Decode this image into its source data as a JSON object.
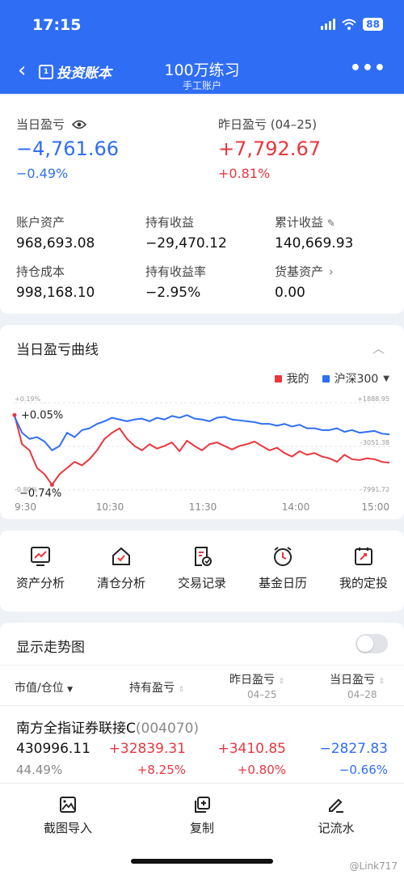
{
  "status": {
    "time": "17:15",
    "battery": "88"
  },
  "nav": {
    "brand": "投资账本",
    "title": "100万练习",
    "subtitle": "手工账户"
  },
  "colors": {
    "primary": "#2f6ef4",
    "down": "#2f6ef4",
    "up": "#e8373e"
  },
  "summary": {
    "today_label": "当日盈亏",
    "today_value": "−4,761.66",
    "today_pct": "−0.49%",
    "yesterday_label": "昨日盈亏 (04–25)",
    "yesterday_value": "+7,792.67",
    "yesterday_pct": "+0.81%",
    "metrics": [
      {
        "label": "账户资产",
        "value": "968,693.08"
      },
      {
        "label": "持有收益",
        "value": "−29,470.12"
      },
      {
        "label": "累计收益",
        "value": "140,669.93"
      },
      {
        "label": "持仓成本",
        "value": "998,168.10"
      },
      {
        "label": "持有收益率",
        "value": "−2.95%"
      },
      {
        "label": "货基资产",
        "value": "0.00"
      }
    ]
  },
  "chart_section": {
    "title": "当日盈亏曲线",
    "legend": [
      "我的",
      "沪深300"
    ]
  },
  "chart_data": {
    "type": "line",
    "x_ticks": [
      "9:30",
      "10:30",
      "11:30",
      "14:00",
      "15:00"
    ],
    "left_axis_labels": [
      "+0.19%",
      "-0.80%"
    ],
    "right_axis_labels": [
      "+1888.95",
      "-3051.38",
      "-7991.72"
    ],
    "annotations": [
      "+0.05%",
      "−0.74%"
    ],
    "x": [
      0,
      2,
      4,
      6,
      8,
      10,
      12,
      14,
      16,
      18,
      20,
      22,
      24,
      26,
      28,
      30,
      32,
      34,
      36,
      38,
      40,
      42,
      44,
      46,
      48,
      50,
      52,
      54,
      56,
      58,
      60,
      62,
      64,
      66,
      68,
      70,
      72,
      74,
      76,
      78,
      80,
      82,
      84,
      86,
      88,
      90,
      92,
      94,
      96,
      98,
      100
    ],
    "series": [
      {
        "name": "我的",
        "color": "#e8373e",
        "values": [
          0.05,
          -0.28,
          -0.35,
          -0.55,
          -0.62,
          -0.74,
          -0.62,
          -0.55,
          -0.48,
          -0.52,
          -0.45,
          -0.35,
          -0.22,
          -0.15,
          -0.1,
          -0.22,
          -0.3,
          -0.35,
          -0.28,
          -0.33,
          -0.3,
          -0.26,
          -0.36,
          -0.24,
          -0.3,
          -0.35,
          -0.28,
          -0.26,
          -0.3,
          -0.34,
          -0.3,
          -0.28,
          -0.25,
          -0.3,
          -0.35,
          -0.32,
          -0.38,
          -0.42,
          -0.36,
          -0.4,
          -0.38,
          -0.42,
          -0.44,
          -0.48,
          -0.4,
          -0.45,
          -0.46,
          -0.44,
          -0.45,
          -0.48,
          -0.49
        ]
      },
      {
        "name": "沪深300",
        "color": "#2f6ef4",
        "values": [
          0.03,
          -0.15,
          -0.22,
          -0.2,
          -0.25,
          -0.35,
          -0.3,
          -0.15,
          -0.2,
          -0.12,
          -0.1,
          -0.05,
          -0.02,
          0.02,
          0.0,
          -0.02,
          0.0,
          0.01,
          -0.02,
          0.02,
          0.0,
          0.04,
          0.02,
          0.05,
          0.01,
          0.0,
          -0.02,
          0.02,
          0.03,
          0.0,
          -0.01,
          -0.02,
          -0.03,
          -0.05,
          -0.05,
          -0.07,
          -0.05,
          -0.08,
          -0.06,
          -0.1,
          -0.1,
          -0.12,
          -0.12,
          -0.1,
          -0.14,
          -0.12,
          -0.15,
          -0.14,
          -0.13,
          -0.16,
          -0.17
        ]
      }
    ],
    "ylim": [
      -0.8,
      0.19
    ]
  },
  "shortcuts": [
    {
      "label": "资产分析",
      "icon": "chart-icon"
    },
    {
      "label": "清仓分析",
      "icon": "house-icon"
    },
    {
      "label": "交易记录",
      "icon": "record-icon"
    },
    {
      "label": "基金日历",
      "icon": "clock-icon"
    },
    {
      "label": "我的定投",
      "icon": "calendar-icon"
    }
  ],
  "holdings": {
    "title": "显示走势图",
    "columns": [
      {
        "label": "市值/仓位",
        "sub": ""
      },
      {
        "label": "持有盈亏",
        "sub": ""
      },
      {
        "label": "昨日盈亏",
        "sub": "04–25"
      },
      {
        "label": "当日盈亏",
        "sub": "04–28"
      }
    ],
    "rows": [
      {
        "name": "南方全指证券联接C",
        "code": "(004070)",
        "market_value": "430996.11",
        "position": "44.49%",
        "hold_profit": "+32839.31",
        "hold_pct": "+8.25%",
        "yesterday": "+3410.85",
        "yesterday_pct": "+0.80%",
        "today": "−2827.83",
        "today_pct": "−0.66%"
      }
    ]
  },
  "bottom_bar": {
    "screenshot_import": "截图导入",
    "copy": "复制",
    "log_flow": "记流水"
  },
  "watermark": "@Link717"
}
